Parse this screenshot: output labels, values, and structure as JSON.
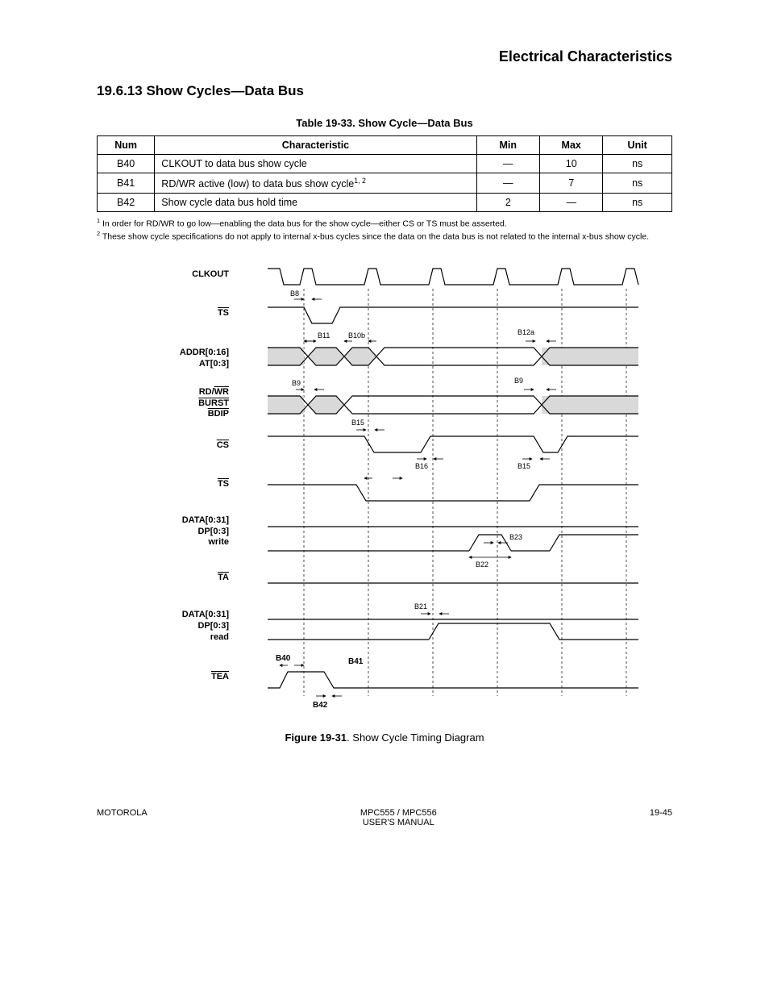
{
  "top_right": "Electrical Characteristics",
  "heading": "19.6.13 Show Cycles—Data Bus",
  "table_caption": "Table 19-33. Show Cycle—Data Bus",
  "table": {
    "headers": [
      "Num",
      "Characteristic",
      "Min",
      "Max",
      "Unit"
    ],
    "rows": [
      {
        "num": "B40",
        "characteristic": "CLKOUT to data bus show cycle",
        "min": "—",
        "max": "10",
        "unit": "ns"
      },
      {
        "num": "B41",
        "characteristic": "RD/WR active (low) to data bus show cycle",
        "refs": "1, 2",
        "min": "—",
        "max": "7",
        "unit": "ns"
      },
      {
        "num": "B42",
        "characteristic": "Show cycle data bus hold time",
        "min": "2",
        "max": "—",
        "unit": "ns"
      }
    ],
    "footnotes": [
      "In order for RD/WR to go low—enabling the data bus for the show cycle—either CS or TS must be asserted.",
      "These show cycle specifications do not apply to internal x-bus cycles since the data on the data bus is not related to the internal x-bus show cycle."
    ]
  },
  "figure_caption": "Figure 19-31",
  "figure_label": ". Show Cycle Timing Diagram",
  "signals": {
    "clkout": "CLKOUT",
    "ts": "TS",
    "addr": "ADDR[0:16]\nAT[0:3]",
    "rw": "RD/WR\nBURST\nBDIP",
    "cs": "CS",
    "ts2": "TS",
    "data_write": "DATA[0:31]\nDP[0:3]\nwrite",
    "ta": "TA",
    "data_read": "DATA[0:31]\nDP[0:3]\nread",
    "tea": "TEA"
  },
  "timings": {
    "b8": "B8",
    "b11": "B11",
    "b10b": "B10b",
    "b12a": "B12a",
    "b9": "B9",
    "b15": "B15",
    "b16": "B16",
    "b22": "B22",
    "b23": "B23",
    "b21": "B21",
    "b40": "B40",
    "b41": "B41",
    "b42": "B42"
  },
  "footer": {
    "left": "MOTOROLA",
    "center": "MPC555 / MPC556\nUSER'S MANUAL",
    "right": "19-45"
  }
}
